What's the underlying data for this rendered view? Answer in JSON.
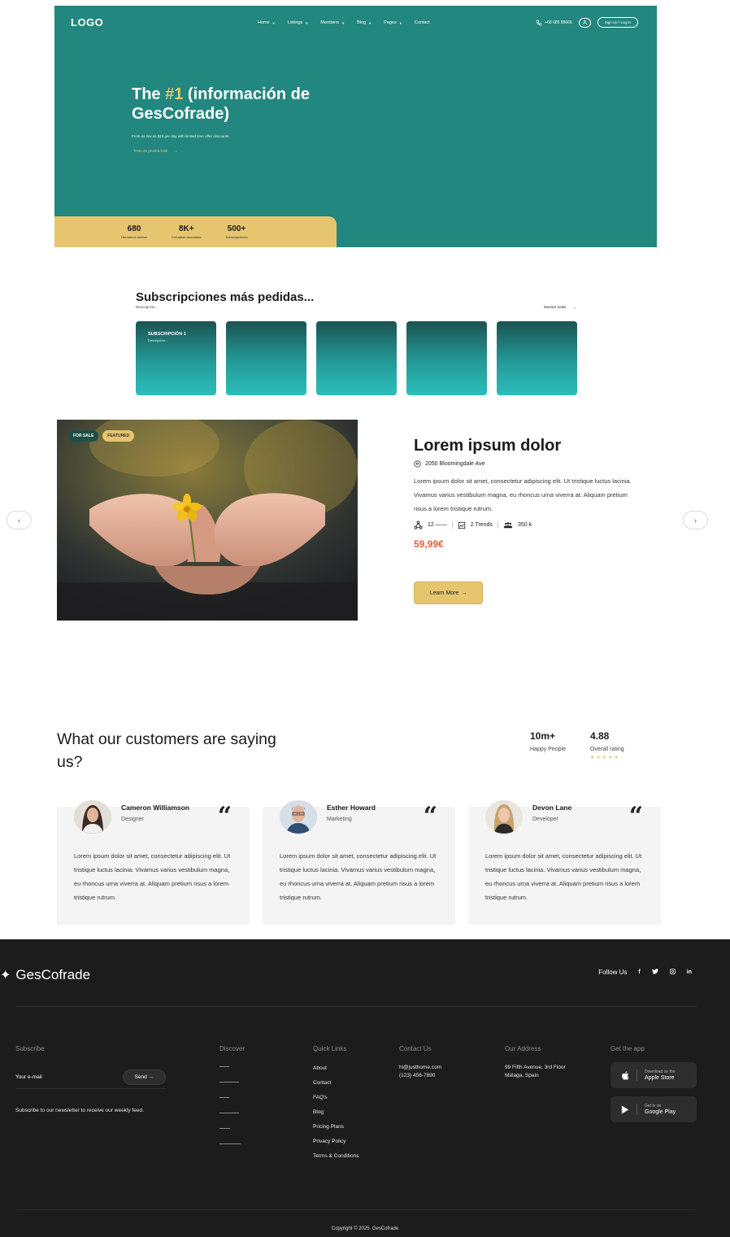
{
  "header": {
    "logo": "LOGO",
    "nav": [
      {
        "label": "Home"
      },
      {
        "label": "Listings"
      },
      {
        "label": "Members"
      },
      {
        "label": "Blog"
      },
      {
        "label": "Pages"
      },
      {
        "label": "Contact"
      }
    ],
    "phone": "+68 685 88666",
    "signup": "Sign Up / Log In"
  },
  "hero": {
    "title_prefix": "The ",
    "title_highlight": "#1",
    "title_rest": " (información de GesCofrade)",
    "subtitle": "From as low as $10 per day with limited time offer discounts.",
    "link": "Texto de prueba linkk",
    "link_arrow": "→",
    "stats": [
      {
        "num": "680",
        "label": "Hermanos activos"
      },
      {
        "num": "8K+",
        "label": "Cofradías asociadas"
      },
      {
        "num": "500+",
        "label": "Subscripciones"
      }
    ]
  },
  "subscriptions": {
    "title": "Subscripciones más pedidas...",
    "description": "Descripción...",
    "show_all": "Mostrar todas",
    "arrow": "→",
    "cards": [
      {
        "title": "SUBSCRIPCIÓN 1",
        "desc": "Descripción..."
      },
      {
        "title": "",
        "desc": ""
      },
      {
        "title": "",
        "desc": ""
      },
      {
        "title": "",
        "desc": ""
      },
      {
        "title": "",
        "desc": ""
      }
    ]
  },
  "listing": {
    "tag_sale": "FOR SALE",
    "tag_featured": "FEATURED",
    "title": "Lorem ipsum dolor",
    "address": "2050 Bloomingdale Ave",
    "description": "Lorem ipsum dolor sit amet, consectetur adipiscing elit. Ut tristique luctus lacinia. Vivamus varius vestibulum magna, eu rhoncus urna viverra at. Aliquam pretium risus a lorem tristique rutrum.",
    "meta_1": "12 ——",
    "meta_2": "2 Trends",
    "meta_3": "350 k",
    "price": "59,99€",
    "button": "Learn More",
    "button_arrow": "→",
    "prev": "‹",
    "next": "›"
  },
  "testimonials": {
    "title": "What our customers are saying us?",
    "stats": [
      {
        "num": "10m+",
        "label": "Happy People"
      },
      {
        "num": "4.88",
        "label": "Overall rating"
      }
    ],
    "stars": "★★★★★",
    "rating": 5,
    "items": [
      {
        "name": "Cameron Williamson",
        "role": "Designer",
        "quote": "Lorem ipsum dolor sit amet, consectetur adipiscing elit. Ut tristique luctus lacinia. Vivamus varius vestibulum magna, eu rhoncus urna viverra at. Aliquam pretium risus a lorem tristique rutrum."
      },
      {
        "name": "Esther Howard",
        "role": "Marketing",
        "quote": "Lorem ipsum dolor sit amet, consectetur adipiscing elit. Ut tristique luctus lacinia. Vivamus varius vestibulum magna, eu rhoncus urna viverra at. Aliquam pretium risus a lorem tristique rutrum."
      },
      {
        "name": "Devon Lane",
        "role": "Developer",
        "quote": "Lorem ipsum dolor sit amet, consectetur adipiscing elit. Ut tristique luctus lacinia. Vivamus varius vestibulum magna, eu rhoncus urna viverra at. Aliquam pretium risus a lorem tristique rutrum."
      }
    ],
    "quote_mark": "“"
  },
  "footer": {
    "brand": "GesCofrade",
    "follow": "Follow Us",
    "socials": [
      "f",
      "🐦",
      "◎",
      "in"
    ],
    "subscribe": {
      "heading": "Subscribe",
      "placeholder": "Your e-mail",
      "send": "Send",
      "send_arrow": "→",
      "note": "Subscribe to our newsletter to receive our weekly feed."
    },
    "discover": {
      "heading": "Discover"
    },
    "quick_links": {
      "heading": "Quick Links",
      "items": [
        "About",
        "Contact",
        "FAQ's",
        "Blog",
        "Pricing Plans",
        "Privacy Policy",
        "Terms & Conditions"
      ]
    },
    "contact": {
      "heading": "Contact Us",
      "email": "hi@justhome.com",
      "phone": "(123) 456-7890"
    },
    "address": {
      "heading": "Our Address",
      "line1": "99 Fifth Avenue, 3rd Floor",
      "line2": "Málaga, Spain"
    },
    "app": {
      "heading": "Get the app",
      "apple_small": "Download on the",
      "apple_big": "Apple Store",
      "google_small": "Get in on",
      "google_big": "Google Play"
    },
    "copyright": "Copyright © 2025. GesCofrade"
  },
  "colors": {
    "primary": "#22877e",
    "accent": "#e6c56f",
    "price": "#e0623a",
    "footer_bg": "#1c1c1c"
  }
}
